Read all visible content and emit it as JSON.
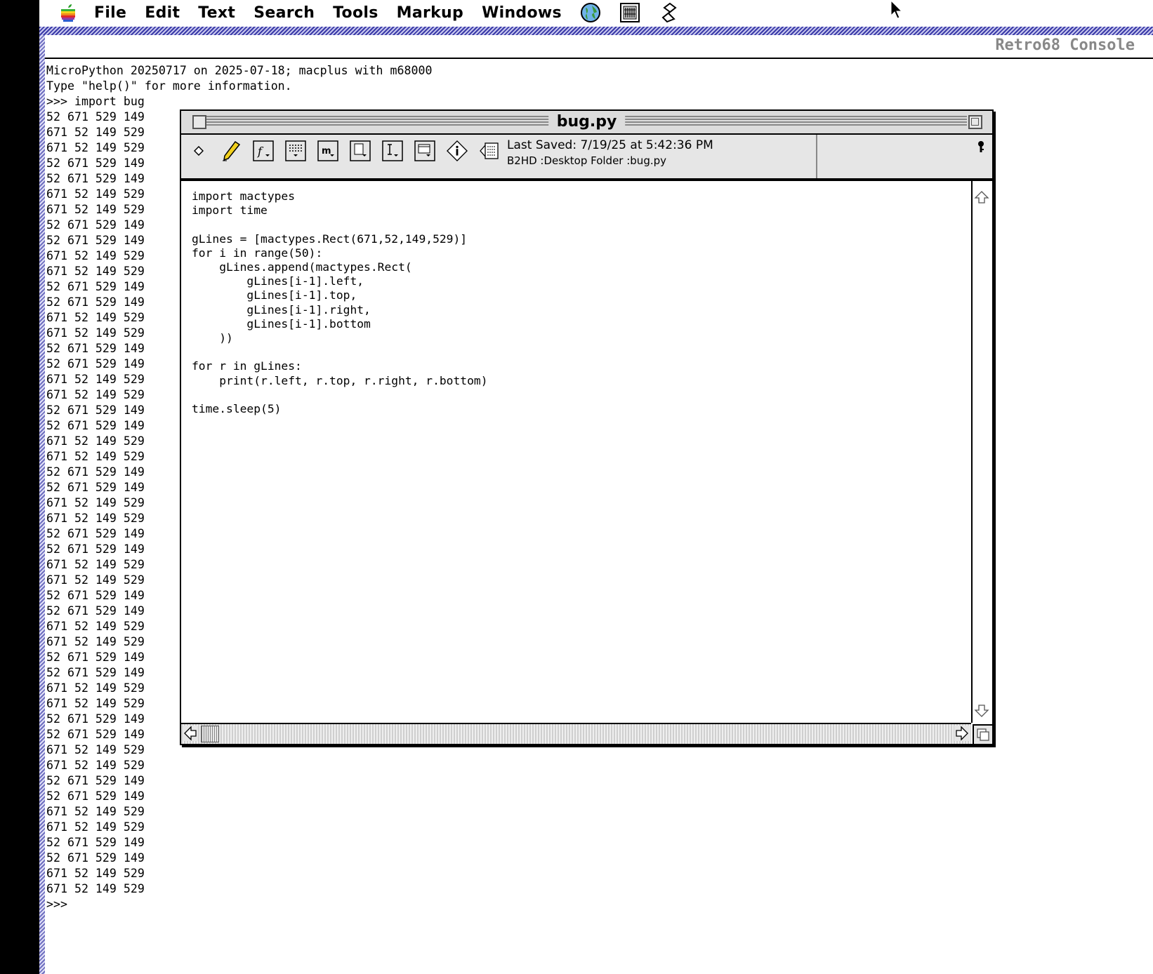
{
  "menubar": {
    "items": [
      "File",
      "Edit",
      "Text",
      "Search",
      "Tools",
      "Markup",
      "Windows"
    ],
    "icons": [
      "globe-icon",
      "calculator-icon",
      "script-icon"
    ]
  },
  "console": {
    "title": "Retro68 Console",
    "lines": [
      "MicroPython 20250717 on 2025-07-18; macplus with m68000",
      "Type \"help()\" for more information.",
      ">>> import bug",
      "52 671 529 149",
      "671 52 149 529",
      "671 52 149 529",
      "52 671 529 149",
      "52 671 529 149",
      "671 52 149 529",
      "671 52 149 529",
      "52 671 529 149",
      "52 671 529 149",
      "671 52 149 529",
      "671 52 149 529",
      "52 671 529 149",
      "52 671 529 149",
      "671 52 149 529",
      "671 52 149 529",
      "52 671 529 149",
      "52 671 529 149",
      "671 52 149 529",
      "671 52 149 529",
      "52 671 529 149",
      "52 671 529 149",
      "671 52 149 529",
      "671 52 149 529",
      "52 671 529 149",
      "52 671 529 149",
      "671 52 149 529",
      "671 52 149 529",
      "52 671 529 149",
      "52 671 529 149",
      "671 52 149 529",
      "671 52 149 529",
      "52 671 529 149",
      "52 671 529 149",
      "671 52 149 529",
      "671 52 149 529",
      "52 671 529 149",
      "52 671 529 149",
      "671 52 149 529",
      "671 52 149 529",
      "52 671 529 149",
      "52 671 529 149",
      "671 52 149 529",
      "671 52 149 529",
      "52 671 529 149",
      "52 671 529 149",
      "671 52 149 529",
      "671 52 149 529",
      "52 671 529 149",
      "52 671 529 149",
      "671 52 149 529",
      "671 52 149 529",
      ">>>"
    ]
  },
  "editor": {
    "title": "bug.py",
    "last_saved": "Last Saved: 7/19/25 at 5:42:36 PM",
    "path": "B2HD :Desktop Folder :bug.py",
    "code": "import mactypes\nimport time\n\ngLines = [mactypes.Rect(671,52,149,529)]\nfor i in range(50):\n    gLines.append(mactypes.Rect(\n        gLines[i-1].left,\n        gLines[i-1].top,\n        gLines[i-1].right,\n        gLines[i-1].bottom\n    ))\n\nfor r in gLines:\n    print(r.left, r.top, r.right, r.bottom)\n\ntime.sleep(5)"
  }
}
